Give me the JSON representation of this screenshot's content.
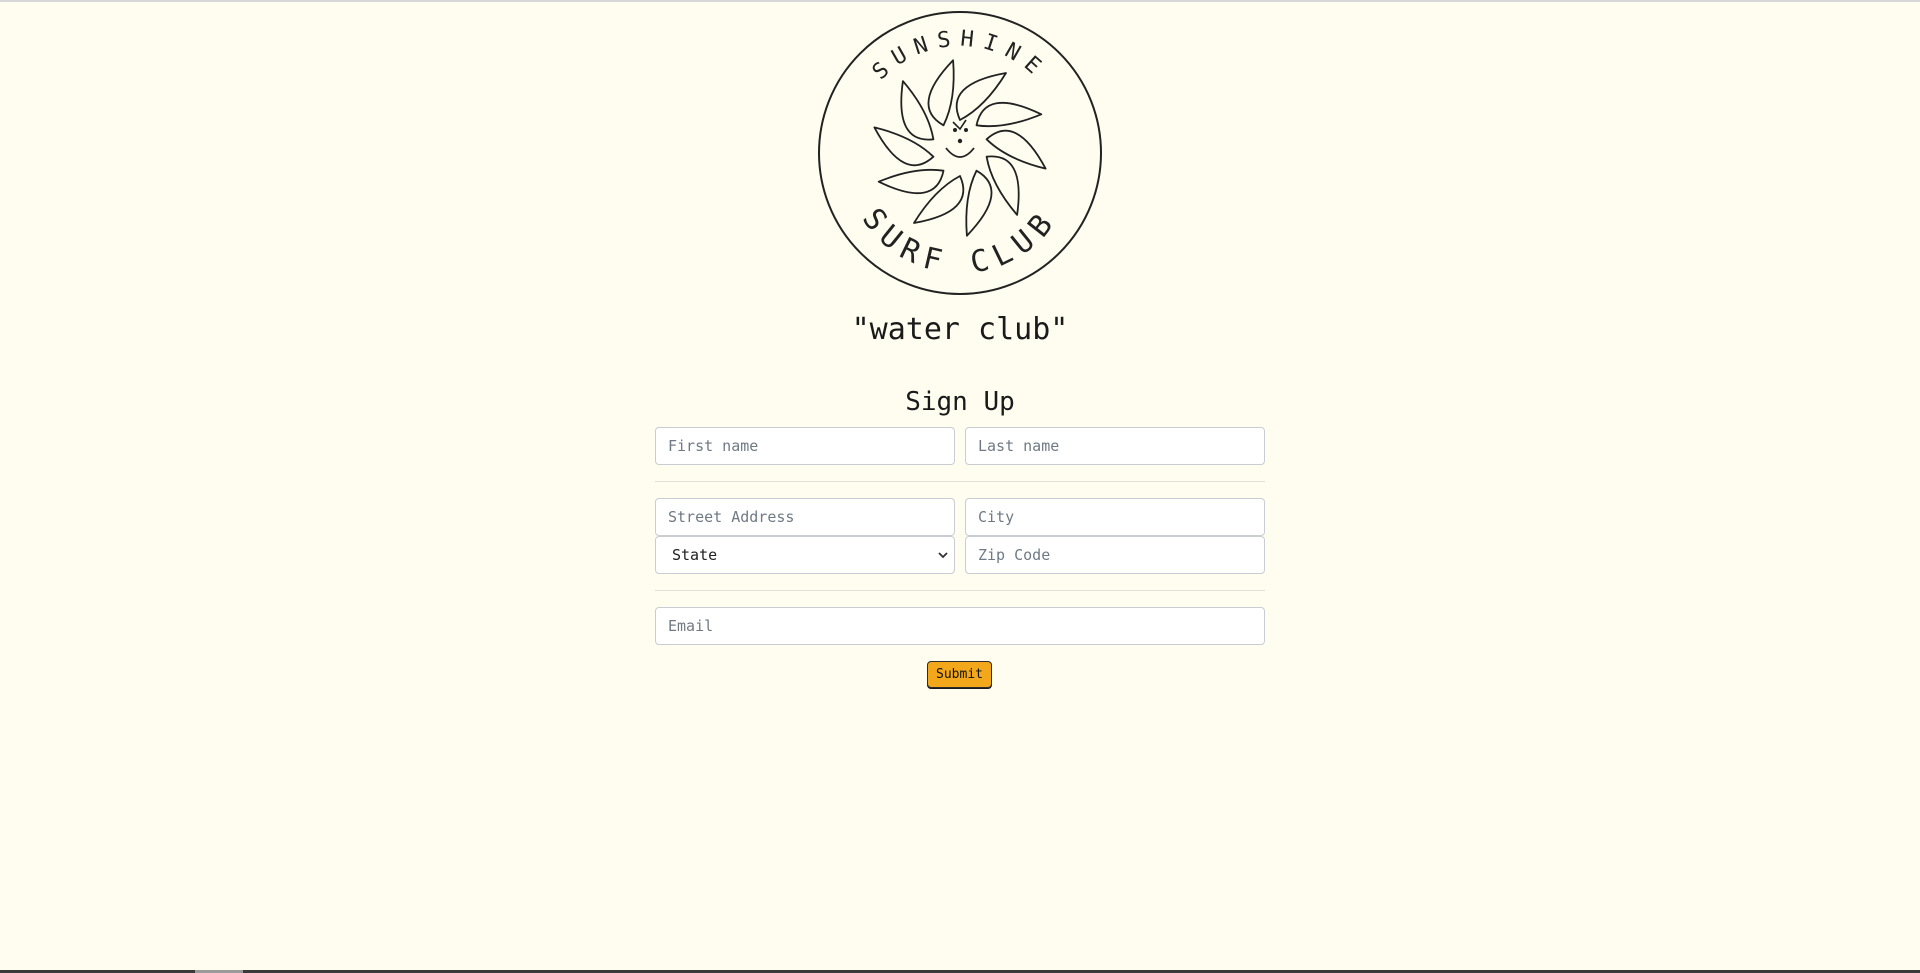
{
  "brand": {
    "logo_text_top": "SUNSHINE",
    "logo_text_bottom": "SURF CLUB",
    "tagline": "\"water club\""
  },
  "form": {
    "title": "Sign Up",
    "first_name": {
      "placeholder": "First name",
      "value": ""
    },
    "last_name": {
      "placeholder": "Last name",
      "value": ""
    },
    "street_address": {
      "placeholder": "Street Address",
      "value": ""
    },
    "city": {
      "placeholder": "City",
      "value": ""
    },
    "state": {
      "selected": "State"
    },
    "zip_code": {
      "placeholder": "Zip Code",
      "value": ""
    },
    "email": {
      "placeholder": "Email",
      "value": ""
    },
    "submit_label": "Submit"
  },
  "colors": {
    "background": "#fffdef",
    "submit_button": "#f3a81b"
  }
}
